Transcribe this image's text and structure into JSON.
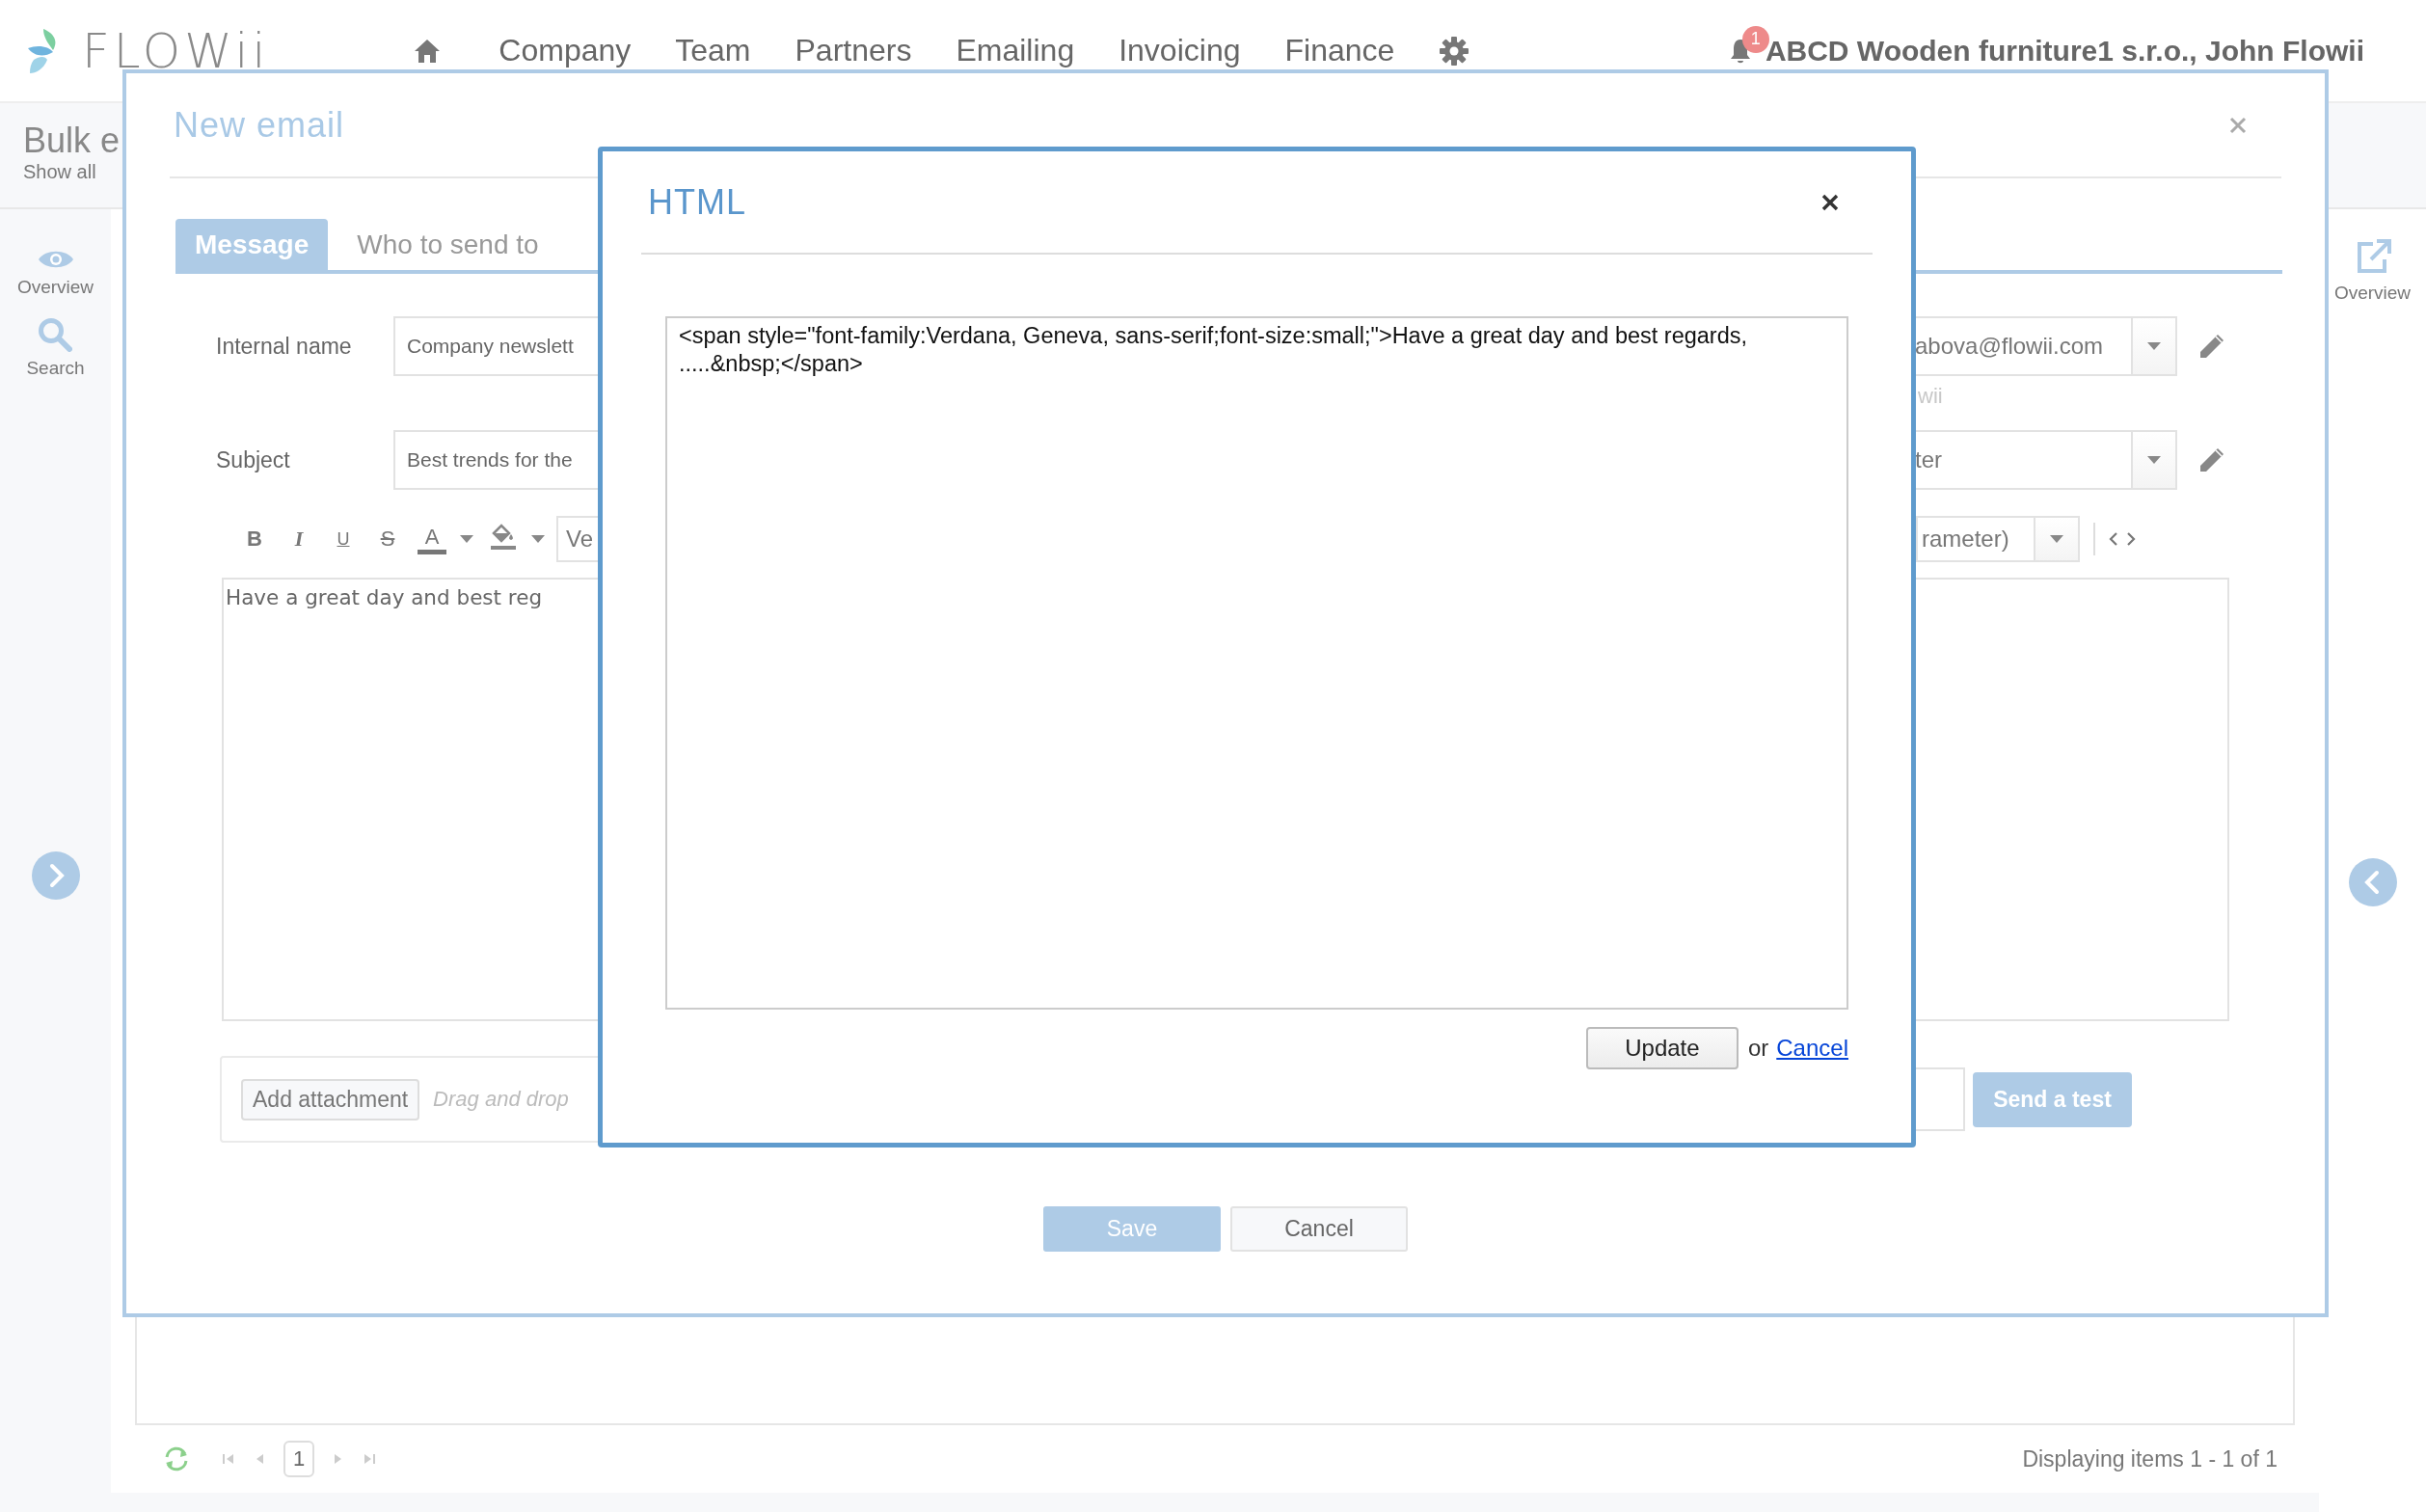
{
  "app": {
    "logo": "FLOWii"
  },
  "nav": [
    {
      "label": "Company"
    },
    {
      "label": "Team"
    },
    {
      "label": "Partners"
    },
    {
      "label": "Emailing"
    },
    {
      "label": "Invoicing"
    },
    {
      "label": "Finance"
    }
  ],
  "user": {
    "notifications": "1",
    "account": "ABCD Wooden furniture1 s.r.o., John Flowii"
  },
  "page": {
    "title": "Bulk e",
    "subtitle": "Show all"
  },
  "left_sidebar": [
    {
      "label": "Overview",
      "kind": "eye"
    },
    {
      "label": "Search",
      "kind": "search"
    }
  ],
  "right_sidebar": [
    {
      "label": "Overview",
      "kind": "external"
    }
  ],
  "pager": {
    "page": "1",
    "summary": "Displaying items 1 - 1 of 1"
  },
  "email_dialog": {
    "title": "New email",
    "tabs": [
      {
        "label": "Message",
        "selected": true
      },
      {
        "label": "Who to send to",
        "selected": false
      }
    ],
    "fields": [
      {
        "label": "Internal name",
        "value": "Company newslett",
        "right_value": "abova@flowii.com"
      },
      {
        "label": "Subject",
        "value": "Best trends for the",
        "right_value": "ter"
      }
    ],
    "sender_hint": "wii",
    "toolbar": [
      {
        "label": "B",
        "kind": "bold"
      },
      {
        "label": "I",
        "kind": "italic"
      },
      {
        "label": "U",
        "kind": "underline"
      },
      {
        "label": "S",
        "kind": "strike"
      },
      {
        "label": "A",
        "kind": "color"
      },
      {
        "kind": "fill"
      }
    ],
    "font_select": "Ve",
    "parameter_select": "rameter)",
    "editor_text": "Have a great day and best reg",
    "attachment": {
      "button": "Add attachment",
      "hint": "Drag and drop"
    },
    "send_test": "Send a test",
    "buttons": [
      "Save",
      "Cancel"
    ]
  },
  "html_dialog": {
    "title": "HTML",
    "code": "<span style=\"font-family:Verdana, Geneva, sans-serif;font-size:small;\">Have a great day and best regards, .....&nbsp;</span>",
    "update": "Update",
    "or": "or",
    "cancel": "Cancel"
  }
}
